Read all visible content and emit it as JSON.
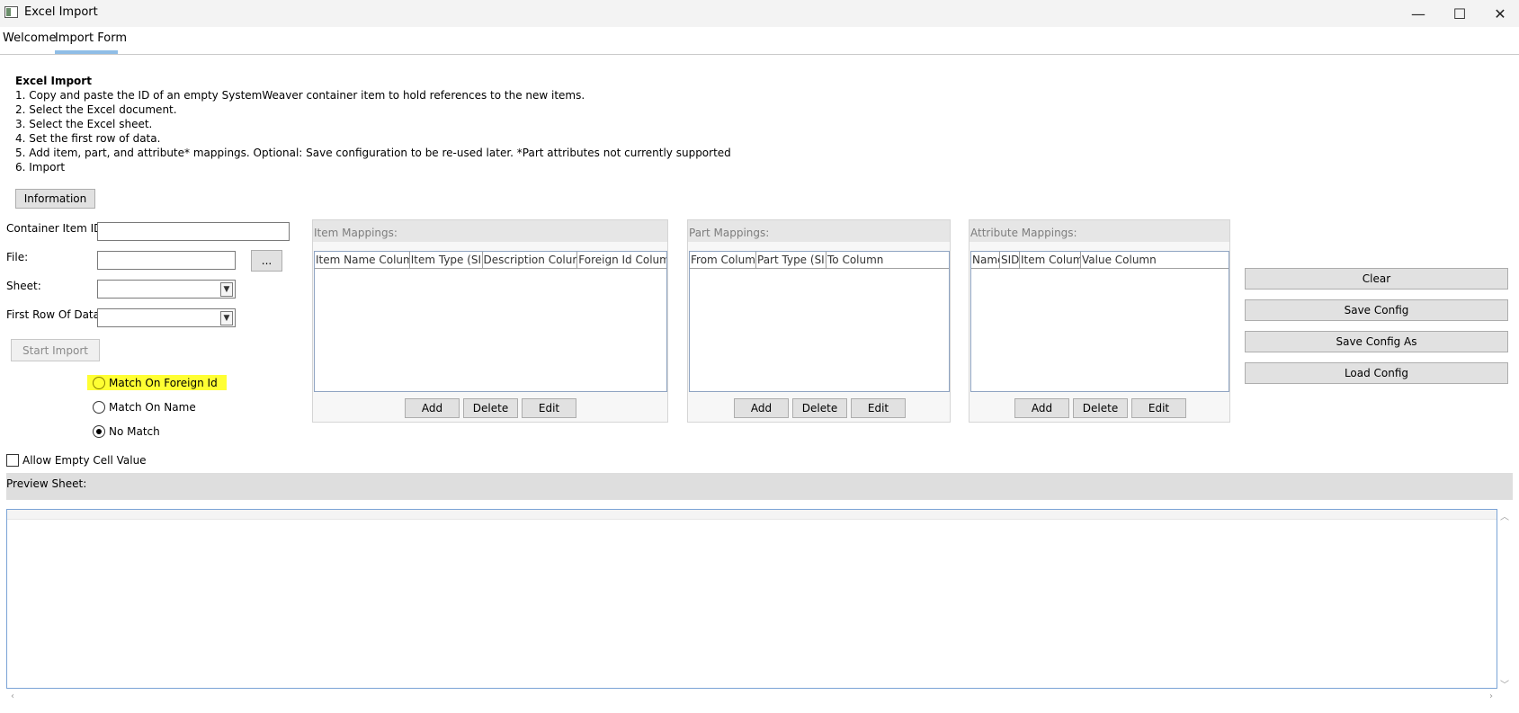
{
  "window": {
    "title": "Excel Import",
    "icons": {
      "app": "excel-app-icon",
      "minimize": "minimize-icon",
      "maximize": "maximize-icon",
      "close": "close-icon"
    },
    "minimize_glyph": "—",
    "maximize_glyph": "☐",
    "close_glyph": "✕"
  },
  "tabs": [
    {
      "label": "Welcome",
      "active": false
    },
    {
      "label": "Import Form",
      "active": true
    }
  ],
  "instructions": {
    "title": "Excel Import",
    "lines": [
      "1. Copy and paste the ID of an empty SystemWeaver container item to hold references to the new items.",
      "2. Select the Excel document.",
      "3. Select the Excel sheet.",
      "4. Set the first row of data.",
      "5. Add item, part, and attribute* mappings. Optional: Save configuration to be re-used later. *Part attributes not currently supported",
      "6. Import"
    ]
  },
  "info_button": "Information",
  "form": {
    "container_label": "Container Item ID:",
    "container_value": "",
    "file_label": "File:",
    "file_value": "",
    "browse_label": "...",
    "sheet_label": "Sheet:",
    "sheet_value": "",
    "first_row_label": "First Row Of Data:",
    "first_row_value": "",
    "start_import": "Start Import"
  },
  "match": {
    "options": [
      {
        "label": "Match On Foreign Id",
        "checked": false,
        "highlighted": true
      },
      {
        "label": "Match On Name",
        "checked": false
      },
      {
        "label": "No Match",
        "checked": true
      }
    ],
    "highlight_color": "#ffff33"
  },
  "allow_empty": {
    "label": "Allow Empty Cell Value",
    "checked": false
  },
  "mappings": {
    "item": {
      "title": "Item Mappings:",
      "columns": [
        "Item Name Column",
        "Item Type (SID)",
        "Description Column",
        "Foreign Id Column"
      ],
      "add": "Add",
      "delete": "Delete",
      "edit": "Edit"
    },
    "part": {
      "title": "Part Mappings:",
      "columns": [
        "From Column",
        "Part Type (SID)",
        "To Column"
      ],
      "add": "Add",
      "delete": "Delete",
      "edit": "Edit"
    },
    "attribute": {
      "title": "Attribute Mappings:",
      "columns": [
        "Name",
        "SID",
        "Item Column",
        "Value Column"
      ],
      "add": "Add",
      "delete": "Delete",
      "edit": "Edit"
    }
  },
  "config_buttons": {
    "clear": "Clear",
    "save": "Save Config",
    "save_as": "Save Config As",
    "load": "Load Config"
  },
  "preview": {
    "label": "Preview Sheet:",
    "scroll_up": "︿",
    "scroll_down": "﹀",
    "scroll_left": "‹",
    "scroll_right": "›"
  }
}
